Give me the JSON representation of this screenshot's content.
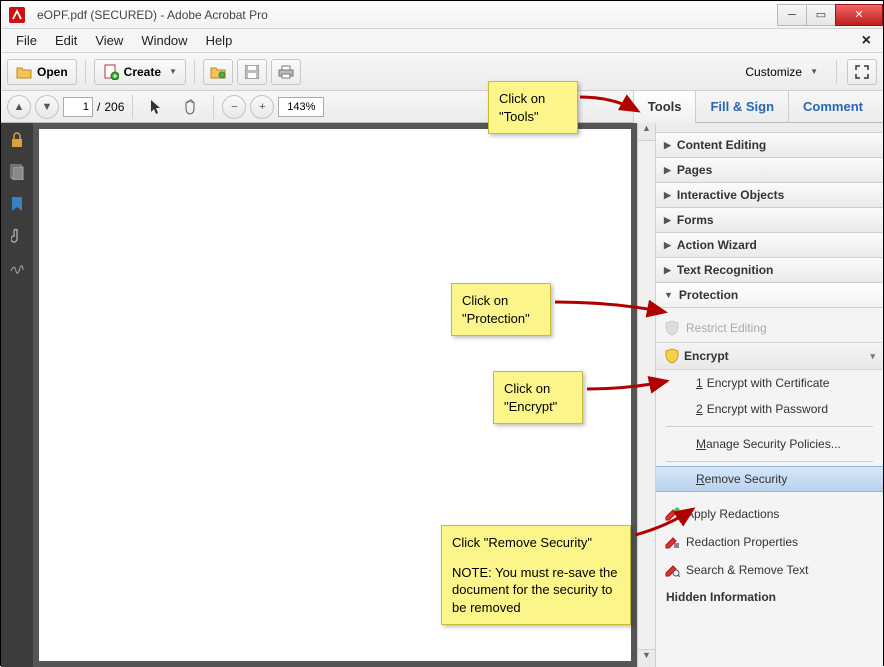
{
  "title": "eOPF.pdf (SECURED) - Adobe Acrobat Pro",
  "menu": {
    "file": "File",
    "edit": "Edit",
    "view": "View",
    "window": "Window",
    "help": "Help"
  },
  "toolbar": {
    "open": "Open",
    "create": "Create",
    "customize": "Customize"
  },
  "nav": {
    "page": "1",
    "total": "206",
    "zoom": "143%"
  },
  "panes": {
    "tools": "Tools",
    "fillsign": "Fill & Sign",
    "comment": "Comment"
  },
  "rp": {
    "content_editing": "Content Editing",
    "pages": "Pages",
    "interactive": "Interactive Objects",
    "forms": "Forms",
    "action_wizard": "Action Wizard",
    "text_rec": "Text Recognition",
    "protection": "Protection",
    "restrict": "Restrict Editing",
    "encrypt": "Encrypt",
    "enc_cert": "Encrypt with Certificate",
    "enc_pwd": "Encrypt with Password",
    "manage": "Manage Security Policies...",
    "remove": "Remove Security",
    "apply_red": "Apply Redactions",
    "red_props": "Redaction Properties",
    "search_remove": "Search & Remove Text",
    "hidden_info": "Hidden Information",
    "enc_1": "1",
    "enc_2": "2",
    "m": "M",
    "r": "R"
  },
  "callouts": {
    "c1a": "Click on",
    "c1b": "\"Tools\"",
    "c2a": "Click on",
    "c2b": "\"Protection\"",
    "c3a": "Click on",
    "c3b": "\"Encrypt\"",
    "c4a": "Click \"Remove Security\"",
    "c4b": "NOTE: You must re-save the document for the security to be removed"
  }
}
